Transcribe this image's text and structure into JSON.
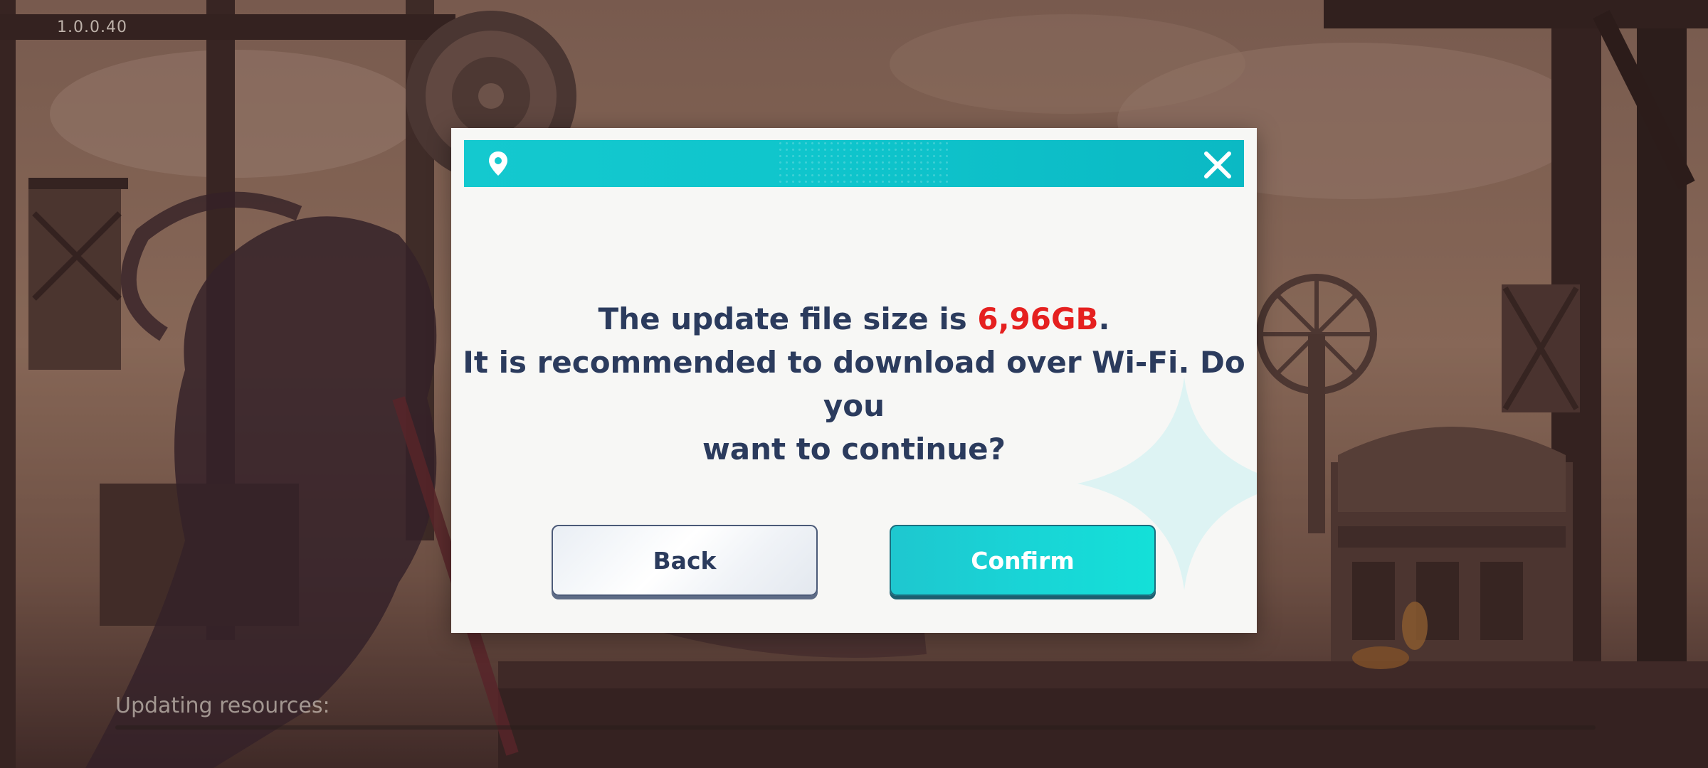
{
  "app": {
    "version": "1.0.0.40",
    "status_text": "Updating resources:",
    "progress": 0
  },
  "dialog": {
    "message_prefix": "The update file size is ",
    "file_size": "6,96GB",
    "message_suffix": ".",
    "message_line2": "It is recommended to download over Wi-Fi. Do you",
    "message_line3": "want to continue?",
    "back_label": "Back",
    "confirm_label": "Confirm",
    "header_icon": "location-pin-icon",
    "close_icon": "close-icon"
  },
  "colors": {
    "header": "#14c9cf",
    "text": "#2b3b5d",
    "highlight": "#e5201f",
    "confirm": "#19d4d6"
  }
}
